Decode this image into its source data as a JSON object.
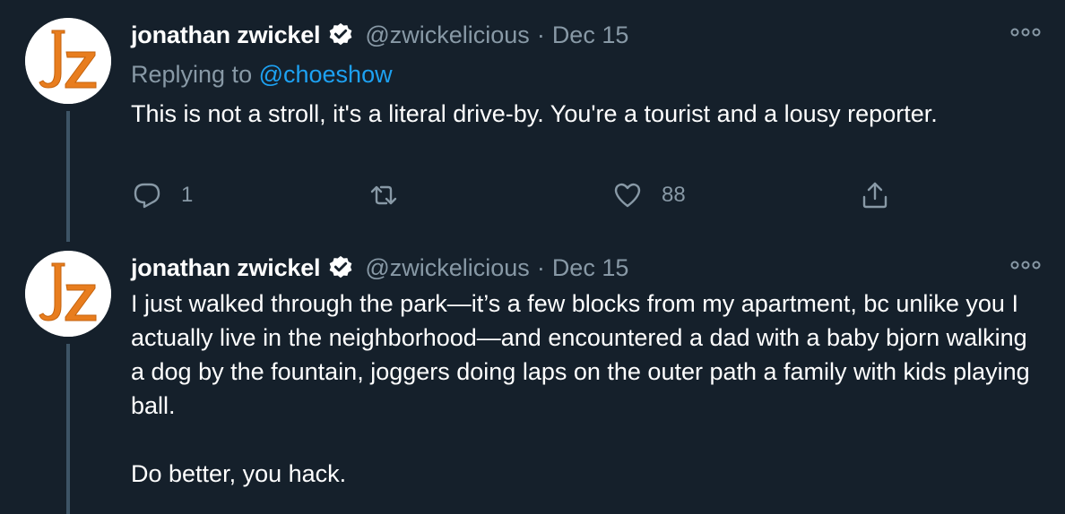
{
  "tweets": [
    {
      "author": {
        "display_name": "jonathan zwickel",
        "handle": "@zwickelicious",
        "verified": true,
        "avatar_text": "JZ"
      },
      "separator": "·",
      "date": "Dec 15",
      "replying_prefix": "Replying to ",
      "replying_to": "@choeshow",
      "text": "This is not a stroll, it's a literal drive-by. You're a tourist and a lousy reporter.",
      "actions": {
        "reply_count": "1",
        "retweet_count": "",
        "like_count": "88"
      }
    },
    {
      "author": {
        "display_name": "jonathan zwickel",
        "handle": "@zwickelicious",
        "verified": true,
        "avatar_text": "JZ"
      },
      "separator": "·",
      "date": "Dec 15",
      "text": "I just walked through the park—it’s a few blocks from my apartment, bc unlike you I actually live in the neighborhood—and encountered a dad with a baby bjorn walking a dog by the fountain, joggers doing laps on the outer path a family with kids playing ball.\n\nDo better, you hack."
    }
  ],
  "icons": {
    "verified": "verified-badge-icon",
    "more": "more-options-icon",
    "reply": "reply-icon",
    "retweet": "retweet-icon",
    "like": "like-icon",
    "share": "share-icon"
  },
  "colors": {
    "background": "#15202b",
    "primary_text": "#ffffff",
    "secondary_text": "#8899a6",
    "link": "#1da1f2",
    "avatar_letters": "#e87d1e",
    "thread_line": "#3d5466"
  }
}
